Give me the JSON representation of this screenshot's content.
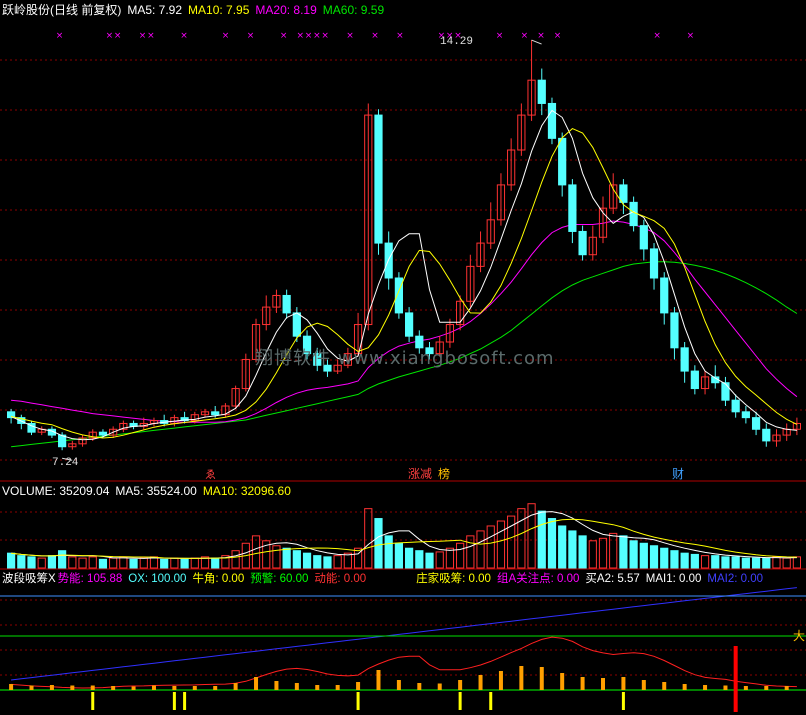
{
  "header": {
    "title": "跃岭股份(日线 前复权)",
    "ma5": "MA5: 7.92",
    "ma10": "MA10: 7.95",
    "ma20": "MA20: 8.19",
    "ma60": "MA60: 9.59"
  },
  "volume_header": {
    "title": "VOLUME: 35209.04",
    "ma5": "MA5: 35524.00",
    "ma10": "MA10: 32096.60"
  },
  "indicator_header": {
    "name": "波段吸筹X",
    "shineng": "势能: 105.88",
    "ox": "OX: 100.00",
    "niujiao": "牛角: 0.00",
    "yujing": "预警: 60.00",
    "dongneng": "动能: 0.00",
    "zhuangjia": "庄家吸筹: 0.00",
    "zua": "组A关注点: 0.00",
    "maia2": "买A2: 5.57",
    "mai1": "MAI1: 0.00",
    "mai2": "MAI2: 0.00"
  },
  "annotations": {
    "high_label": "14.29",
    "low_label": "7.24",
    "tag_zhangjian": "涨减",
    "tag_bang": "榜",
    "tag_cai": "财",
    "tag_small": "ゑ",
    "tag_da": "大",
    "watermark": "翔博软件 www.xiangbosoft.com"
  },
  "colors": {
    "up": "#ff3232",
    "down": "#54ffff",
    "ma5": "#ffffff",
    "ma10": "#ffff00",
    "ma20": "#ff00ff",
    "ma60": "#00e600",
    "grid": "#8b0000",
    "marker": "#ff00ff"
  },
  "chart_data": {
    "type": "candlestick",
    "price_high": 14.29,
    "price_low": 7.24,
    "candles": [
      [
        7.9,
        7.8,
        7.95,
        7.7
      ],
      [
        7.8,
        7.7,
        7.85,
        7.6
      ],
      [
        7.7,
        7.55,
        7.75,
        7.5
      ],
      [
        7.55,
        7.6,
        7.65,
        7.5
      ],
      [
        7.6,
        7.5,
        7.65,
        7.45
      ],
      [
        7.5,
        7.3,
        7.55,
        7.24
      ],
      [
        7.3,
        7.35,
        7.4,
        7.25
      ],
      [
        7.35,
        7.45,
        7.5,
        7.3
      ],
      [
        7.45,
        7.55,
        7.6,
        7.4
      ],
      [
        7.55,
        7.5,
        7.6,
        7.45
      ],
      [
        7.5,
        7.6,
        7.65,
        7.45
      ],
      [
        7.6,
        7.7,
        7.75,
        7.55
      ],
      [
        7.7,
        7.65,
        7.75,
        7.6
      ],
      [
        7.65,
        7.7,
        7.8,
        7.6
      ],
      [
        7.7,
        7.75,
        7.8,
        7.65
      ],
      [
        7.75,
        7.7,
        7.85,
        7.65
      ],
      [
        7.7,
        7.8,
        7.85,
        7.65
      ],
      [
        7.8,
        7.75,
        7.9,
        7.7
      ],
      [
        7.75,
        7.85,
        7.9,
        7.7
      ],
      [
        7.85,
        7.9,
        7.95,
        7.8
      ],
      [
        7.9,
        7.85,
        8.0,
        7.8
      ],
      [
        7.85,
        8.0,
        8.05,
        7.8
      ],
      [
        8.0,
        8.3,
        8.35,
        7.95
      ],
      [
        8.3,
        8.8,
        8.9,
        8.25
      ],
      [
        8.8,
        9.4,
        9.5,
        8.75
      ],
      [
        9.4,
        9.7,
        9.9,
        9.3
      ],
      [
        9.7,
        9.9,
        10.0,
        9.6
      ],
      [
        9.9,
        9.6,
        10.0,
        9.5
      ],
      [
        9.6,
        9.2,
        9.7,
        9.1
      ],
      [
        9.2,
        8.9,
        9.3,
        8.8
      ],
      [
        8.9,
        8.7,
        9.0,
        8.6
      ],
      [
        8.7,
        8.6,
        8.8,
        8.5
      ],
      [
        8.6,
        8.7,
        8.8,
        8.55
      ],
      [
        8.7,
        8.9,
        9.0,
        8.65
      ],
      [
        8.9,
        9.4,
        9.6,
        8.85
      ],
      [
        9.4,
        13.0,
        13.2,
        9.3
      ],
      [
        13.0,
        10.8,
        13.1,
        10.6
      ],
      [
        10.8,
        10.2,
        11.0,
        10.0
      ],
      [
        10.2,
        9.6,
        10.3,
        9.5
      ],
      [
        9.6,
        9.2,
        9.7,
        9.1
      ],
      [
        9.2,
        9.0,
        9.3,
        8.9
      ],
      [
        9.0,
        8.9,
        9.1,
        8.8
      ],
      [
        8.9,
        9.1,
        9.2,
        8.85
      ],
      [
        9.1,
        9.4,
        9.5,
        9.0
      ],
      [
        9.4,
        9.8,
        9.9,
        9.3
      ],
      [
        9.8,
        10.4,
        10.6,
        9.7
      ],
      [
        10.4,
        10.8,
        11.0,
        10.3
      ],
      [
        10.8,
        11.2,
        11.5,
        10.7
      ],
      [
        11.2,
        11.8,
        12.0,
        11.1
      ],
      [
        11.8,
        12.4,
        12.6,
        11.7
      ],
      [
        12.4,
        13.0,
        13.2,
        12.3
      ],
      [
        13.0,
        13.6,
        14.29,
        12.9
      ],
      [
        13.6,
        13.2,
        13.8,
        13.0
      ],
      [
        13.2,
        12.6,
        13.3,
        12.5
      ],
      [
        12.6,
        11.8,
        12.7,
        11.6
      ],
      [
        11.8,
        11.0,
        11.9,
        10.8
      ],
      [
        11.0,
        10.6,
        11.1,
        10.5
      ],
      [
        10.6,
        10.9,
        11.1,
        10.5
      ],
      [
        10.9,
        11.4,
        11.6,
        10.8
      ],
      [
        11.4,
        11.8,
        12.0,
        11.3
      ],
      [
        11.8,
        11.5,
        11.9,
        11.3
      ],
      [
        11.5,
        11.1,
        11.6,
        11.0
      ],
      [
        11.1,
        10.7,
        11.2,
        10.5
      ],
      [
        10.7,
        10.2,
        10.8,
        10.0
      ],
      [
        10.2,
        9.6,
        10.3,
        9.4
      ],
      [
        9.6,
        9.0,
        9.7,
        8.8
      ],
      [
        9.0,
        8.6,
        9.1,
        8.4
      ],
      [
        8.6,
        8.3,
        8.7,
        8.2
      ],
      [
        8.3,
        8.5,
        8.6,
        8.2
      ],
      [
        8.5,
        8.4,
        8.7,
        8.3
      ],
      [
        8.4,
        8.1,
        8.5,
        8.0
      ],
      [
        8.1,
        7.9,
        8.2,
        7.8
      ],
      [
        7.9,
        7.8,
        8.0,
        7.7
      ],
      [
        7.8,
        7.6,
        7.9,
        7.5
      ],
      [
        7.6,
        7.4,
        7.7,
        7.3
      ],
      [
        7.4,
        7.5,
        7.6,
        7.3
      ],
      [
        7.5,
        7.6,
        7.7,
        7.4
      ],
      [
        7.6,
        7.7,
        7.8,
        7.5
      ]
    ],
    "ma5_line": [
      7.82,
      7.74,
      7.66,
      7.6,
      7.57,
      7.49,
      7.44,
      7.42,
      7.43,
      7.47,
      7.55,
      7.62,
      7.65,
      7.66,
      7.7,
      7.72,
      7.74,
      7.76,
      7.77,
      7.81,
      7.83,
      7.86,
      7.96,
      8.17,
      8.53,
      8.92,
      9.27,
      9.52,
      9.6,
      9.48,
      9.25,
      8.98,
      8.82,
      8.77,
      8.86,
      9.58,
      10.09,
      10.52,
      10.84,
      10.96,
      10.96,
      10.0,
      9.44,
      9.44,
      9.44,
      9.68,
      9.98,
      10.38,
      10.86,
      11.36,
      11.82,
      12.38,
      12.82,
      13.08,
      12.96,
      12.6,
      12.0,
      11.58,
      11.32,
      11.14,
      11.26,
      11.34,
      11.24,
      10.94,
      10.48,
      9.92,
      9.36,
      8.9,
      8.6,
      8.48,
      8.38,
      8.18,
      8.02,
      7.88,
      7.72,
      7.64,
      7.6,
      7.58
    ],
    "ma20_line": [
      8.1,
      8.08,
      8.05,
      8.02,
      7.99,
      7.96,
      7.93,
      7.9,
      7.87,
      7.85,
      7.83,
      7.81,
      7.79,
      7.77,
      7.75,
      7.74,
      7.73,
      7.72,
      7.72,
      7.72,
      7.72,
      7.73,
      7.76,
      7.8,
      7.87,
      7.96,
      8.06,
      8.15,
      8.22,
      8.27,
      8.3,
      8.32,
      8.35,
      8.38,
      8.43,
      8.66,
      8.82,
      8.94,
      9.03,
      9.08,
      9.12,
      9.15,
      9.2,
      9.26,
      9.34,
      9.45,
      9.59,
      9.75,
      9.93,
      10.13,
      10.36,
      10.6,
      10.81,
      10.98,
      11.07,
      11.12,
      11.12,
      11.12,
      11.14,
      11.18,
      11.16,
      11.12,
      11.06,
      10.98,
      10.84,
      10.64,
      10.42,
      10.18,
      9.96,
      9.74,
      9.52,
      9.3,
      9.08,
      8.86,
      8.64,
      8.46,
      8.3,
      8.16
    ],
    "ma60_line": [
      7.3,
      7.32,
      7.34,
      7.36,
      7.38,
      7.4,
      7.42,
      7.44,
      7.46,
      7.48,
      7.5,
      7.52,
      7.54,
      7.56,
      7.58,
      7.6,
      7.62,
      7.64,
      7.66,
      7.68,
      7.7,
      7.72,
      7.74,
      7.76,
      7.8,
      7.84,
      7.88,
      7.92,
      7.96,
      8.0,
      8.04,
      8.08,
      8.12,
      8.16,
      8.2,
      8.3,
      8.38,
      8.44,
      8.5,
      8.55,
      8.6,
      8.65,
      8.7,
      8.76,
      8.82,
      8.9,
      8.98,
      9.08,
      9.18,
      9.3,
      9.44,
      9.58,
      9.72,
      9.86,
      9.98,
      10.08,
      10.16,
      10.22,
      10.28,
      10.34,
      10.4,
      10.44,
      10.46,
      10.48,
      10.48,
      10.47,
      10.45,
      10.42,
      10.38,
      10.33,
      10.27,
      10.2,
      10.12,
      10.03,
      9.93,
      9.82,
      9.7,
      9.59
    ],
    "volume": [
      12,
      10,
      9,
      8,
      10,
      14,
      9,
      8,
      9,
      7,
      8,
      9,
      7,
      8,
      9,
      7,
      8,
      7,
      8,
      9,
      8,
      10,
      14,
      20,
      26,
      22,
      18,
      16,
      14,
      12,
      10,
      9,
      10,
      12,
      16,
      48,
      40,
      26,
      20,
      16,
      14,
      12,
      13,
      16,
      20,
      26,
      30,
      34,
      38,
      42,
      48,
      52,
      46,
      40,
      34,
      30,
      26,
      22,
      24,
      28,
      26,
      22,
      20,
      18,
      16,
      14,
      12,
      11,
      10,
      10,
      9,
      9,
      8,
      8,
      8,
      9,
      8,
      9
    ],
    "volume_up": [
      false,
      false,
      false,
      true,
      false,
      false,
      true,
      true,
      true,
      false,
      true,
      true,
      false,
      true,
      true,
      false,
      true,
      false,
      true,
      true,
      false,
      true,
      true,
      true,
      true,
      true,
      true,
      false,
      false,
      false,
      false,
      false,
      true,
      true,
      true,
      true,
      false,
      false,
      false,
      false,
      false,
      false,
      true,
      true,
      true,
      true,
      true,
      true,
      true,
      true,
      true,
      true,
      false,
      false,
      false,
      false,
      false,
      true,
      true,
      true,
      false,
      false,
      false,
      false,
      false,
      false,
      false,
      false,
      true,
      false,
      false,
      false,
      false,
      false,
      false,
      true,
      true,
      true
    ]
  }
}
